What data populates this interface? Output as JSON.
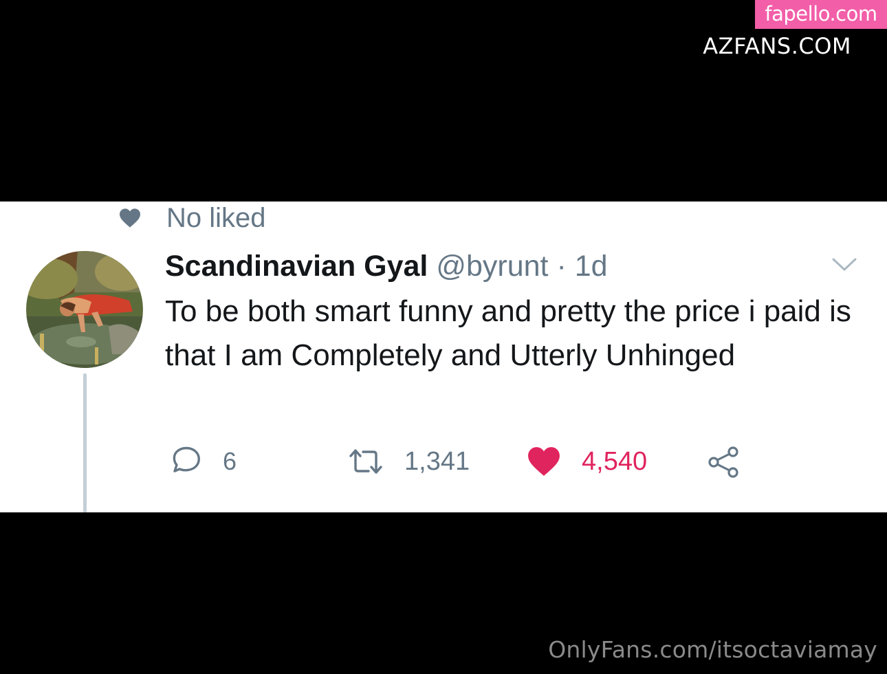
{
  "watermarks": {
    "badge": "fapello.com",
    "top_right": "AZFANS.COM",
    "bottom_right": "OnlyFans.com/itsoctaviamay"
  },
  "context": {
    "icon": "heart-icon",
    "label": "No liked"
  },
  "tweet": {
    "display_name": "Scandinavian Gyal",
    "handle": "@byrunt",
    "separator": "·",
    "time": "1d",
    "text": "To be both smart funny and pretty the price i paid is that I am Completely and Utterly Unhinged",
    "actions": {
      "reply": {
        "icon": "reply-icon",
        "count": "6"
      },
      "retweet": {
        "icon": "retweet-icon",
        "count": "1,341"
      },
      "like": {
        "icon": "heart-filled-icon",
        "count": "4,540",
        "liked": true
      },
      "share": {
        "icon": "share-icon"
      }
    }
  },
  "colors": {
    "background": "#000000",
    "card": "#ffffff",
    "text_primary": "#14171a",
    "text_secondary": "#657786",
    "like": "#e0245e",
    "watermark_badge": "#f25ea8"
  }
}
